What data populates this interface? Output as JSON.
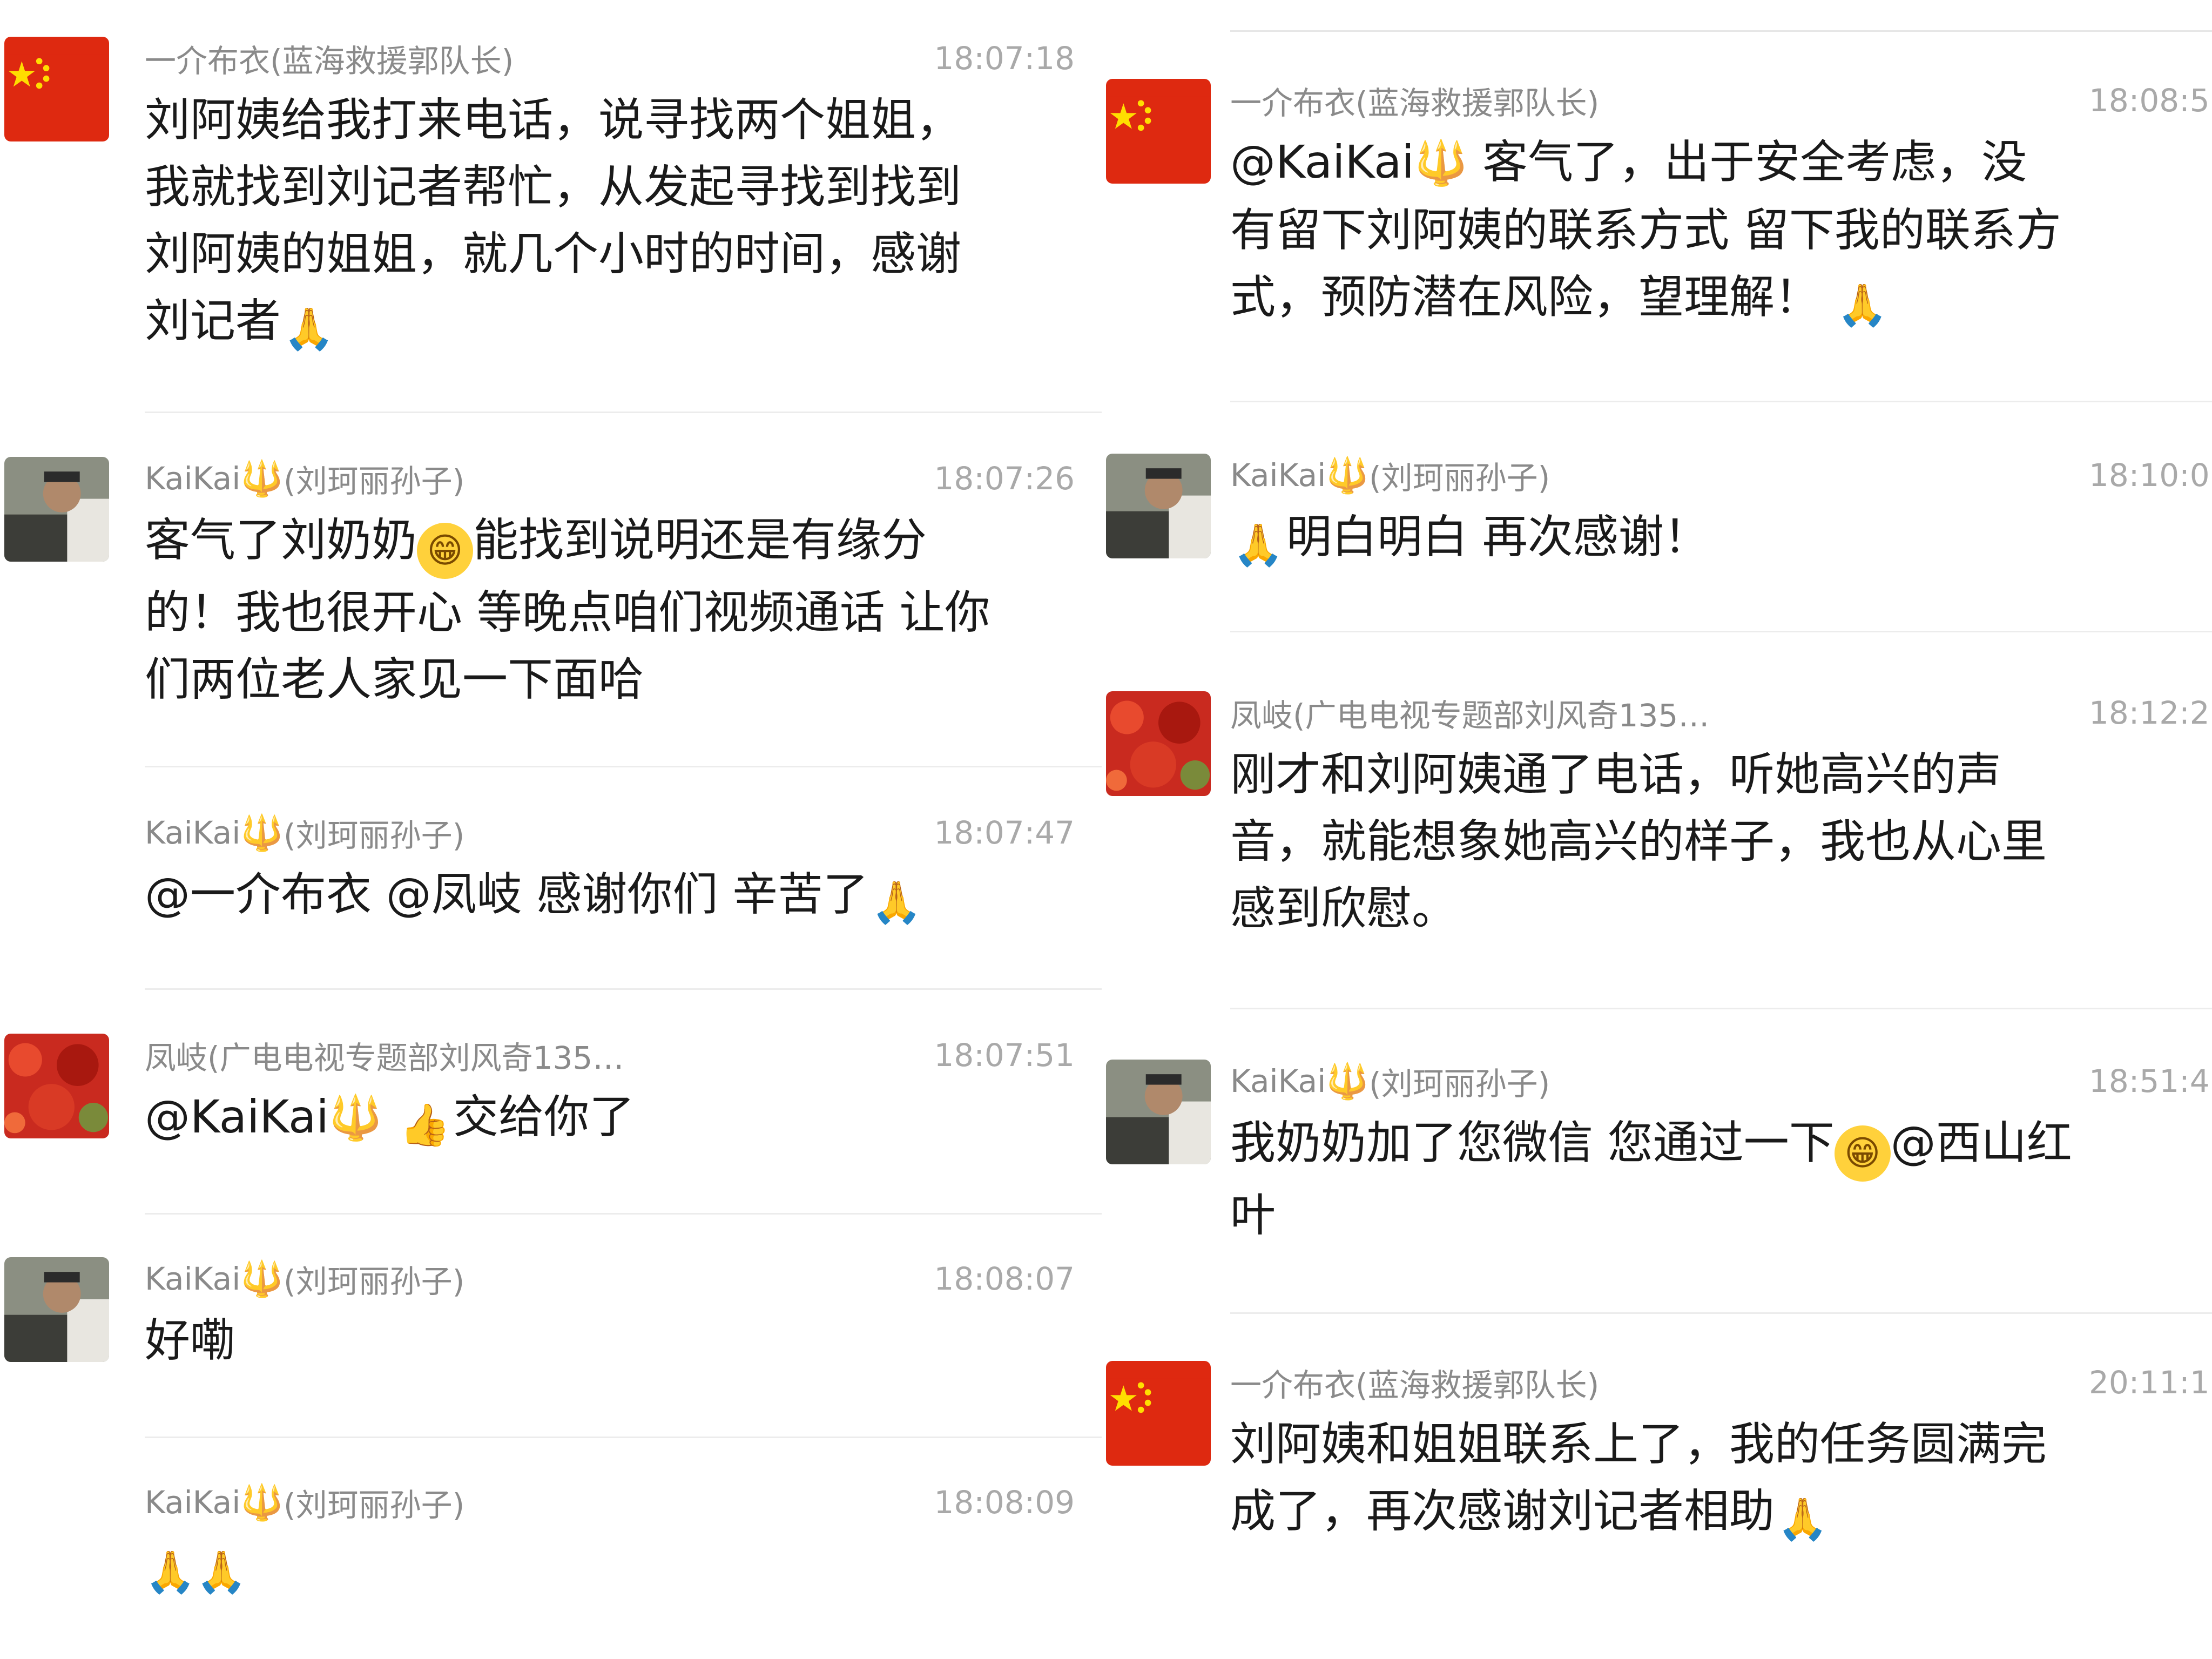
{
  "left": {
    "messages": [
      {
        "sender": "一介布衣(蓝海救援郭队长)",
        "time": "18:07:18",
        "text": "刘阿姨给我打来电话，说寻找两个姐姐，\n我就找到刘记者帮忙，从发起寻找到找到\n刘阿姨的姐姐，就几个小时的时间，感谢\n刘记者",
        "emoji_after": "🙏"
      },
      {
        "sender_name": "KaiKai",
        "sender_icon": "trident-icon",
        "sender_note": "(刘珂丽孙子)",
        "time": "18:07:26",
        "text_a": "客气了刘奶奶",
        "emoji_mid": "😁",
        "text_b": "能找到说明还是有缘分\n的！我也很开心 等晚点咱们视频通话 让你\n们两位老人家见一下面哈"
      },
      {
        "sender_name": "KaiKai",
        "sender_note": "(刘珂丽孙子)",
        "time": "18:07:47",
        "text": "@一介布衣 @凤岐 感谢你们 辛苦了",
        "emoji_after": "🙏"
      },
      {
        "sender": "凤岐(广电电视专题部刘风奇135…",
        "time": "18:07:51",
        "text_a": "@KaiKai",
        "emoji_mid": "👍",
        "text_b": "交给你了"
      },
      {
        "sender_name": "KaiKai",
        "sender_note": "(刘珂丽孙子)",
        "time": "18:08:07",
        "text": "好嘞"
      },
      {
        "sender_name": "KaiKai",
        "sender_note": "(刘珂丽孙子)",
        "time": "18:08:09",
        "emoji": "🙏🙏"
      }
    ]
  },
  "right": {
    "messages": [
      {
        "sender": "一介布衣(蓝海救援郭队长)",
        "time": "18:08:5",
        "text_a": "@KaiKai",
        "text_b": " 客气了，出于安全考虑，没\n有留下刘阿姨的联系方式 留下我的联系方\n式，预防潜在风险，望理解！ ",
        "emoji_after": "🙏"
      },
      {
        "sender_name": "KaiKai",
        "sender_note": "(刘珂丽孙子)",
        "time": "18:10:0",
        "text": "明白明白 再次感谢！",
        "emoji_before": "🙏"
      },
      {
        "sender": "凤岐(广电电视专题部刘风奇135…",
        "time": "18:12:2",
        "text": "刚才和刘阿姨通了电话，听她高兴的声\n音，就能想象她高兴的样子，我也从心里\n感到欣慰。"
      },
      {
        "sender_name": "KaiKai",
        "sender_note": "(刘珂丽孙子)",
        "time": "18:51:4",
        "text_a": "我奶奶加了您微信 您通过一下",
        "emoji_mid": "😁",
        "text_b": "@西山红\n叶"
      },
      {
        "sender": "一介布衣(蓝海救援郭队长)",
        "time": "20:11:1",
        "text": "刘阿姨和姐姐联系上了，我的任务圆满完\n成了，再次感谢刘记者相助",
        "emoji_after": "🙏"
      }
    ]
  },
  "colors": {
    "flag_red": "#de2910",
    "flag_star": "#ffde00",
    "meta_gray": "#8a8a8a",
    "text": "#1a1a1a"
  }
}
